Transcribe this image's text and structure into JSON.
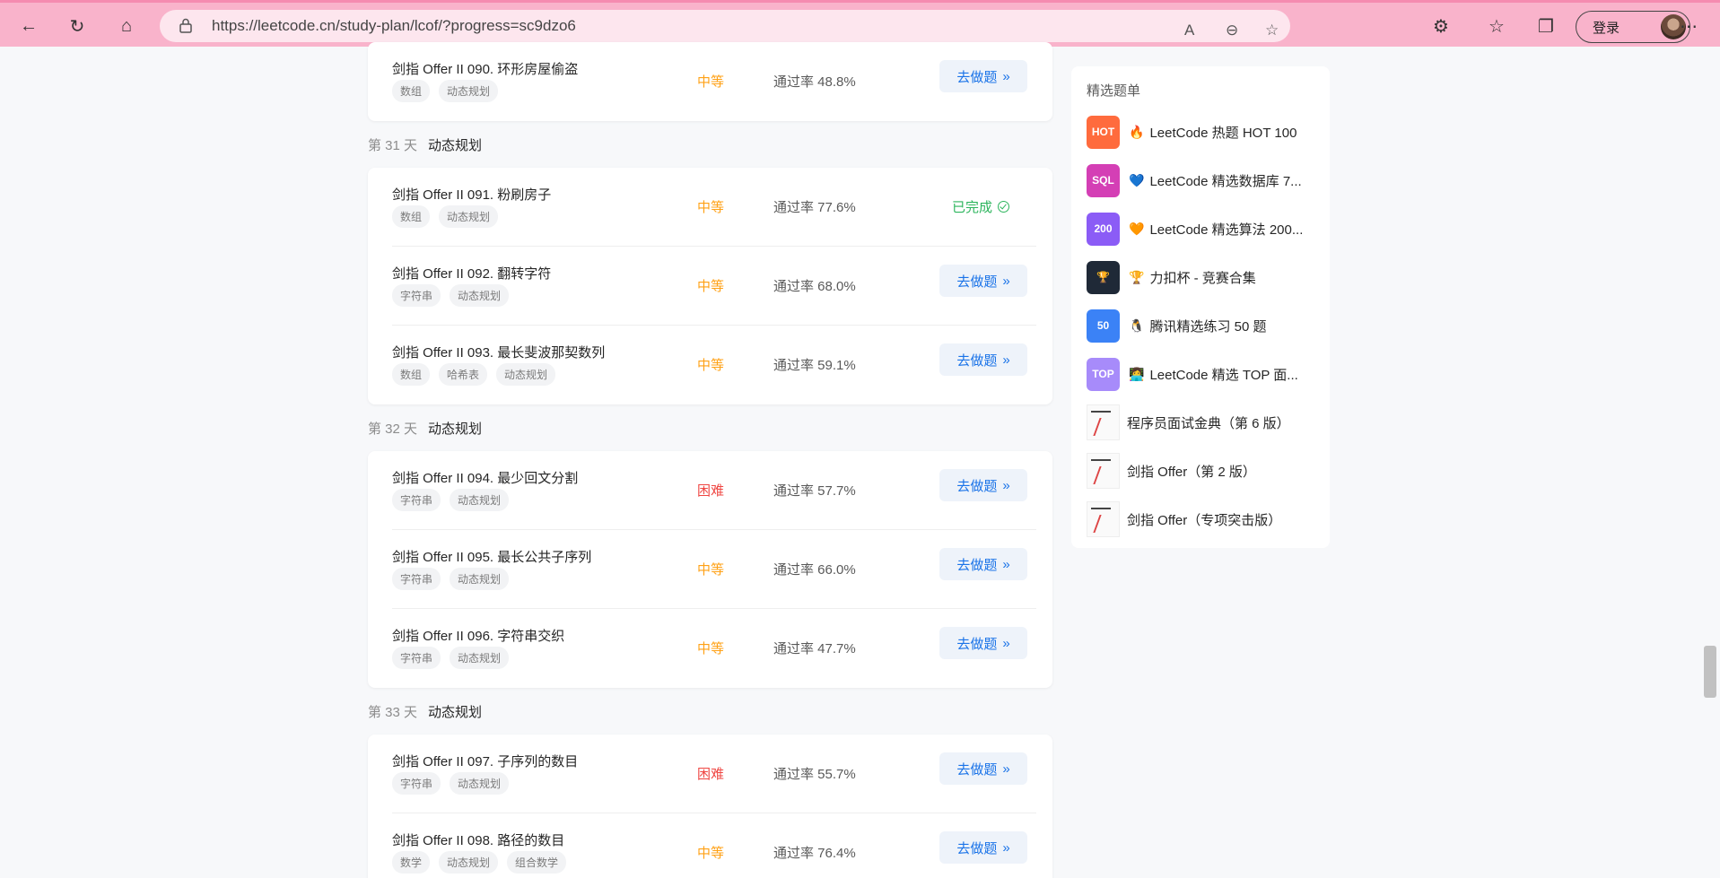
{
  "browser": {
    "url": "https://leetcode.cn/study-plan/lcof/?progress=sc9dzo6",
    "login_label": "登录"
  },
  "first_row": {
    "title": "剑指 Offer II 090. 环形房屋偷盗",
    "tags": [
      "数组",
      "动态规划"
    ],
    "difficulty": "中等",
    "rate": "通过率 48.8%",
    "action": "去做题"
  },
  "days": [
    {
      "num": "第 31 天",
      "topic": "动态规划",
      "problems": [
        {
          "title": "剑指 Offer II 091. 粉刷房子",
          "tags": [
            "数组",
            "动态规划"
          ],
          "difficulty": "中等",
          "rate": "通过率 77.6%",
          "status": "已完成"
        },
        {
          "title": "剑指 Offer II 092. 翻转字符",
          "tags": [
            "字符串",
            "动态规划"
          ],
          "difficulty": "中等",
          "rate": "通过率 68.0%",
          "action": "去做题"
        },
        {
          "title": "剑指 Offer II 093. 最长斐波那契数列",
          "tags": [
            "数组",
            "哈希表",
            "动态规划"
          ],
          "difficulty": "中等",
          "rate": "通过率 59.1%",
          "action": "去做题"
        }
      ]
    },
    {
      "num": "第 32 天",
      "topic": "动态规划",
      "problems": [
        {
          "title": "剑指 Offer II 094. 最少回文分割",
          "tags": [
            "字符串",
            "动态规划"
          ],
          "difficulty": "困难",
          "rate": "通过率 57.7%",
          "action": "去做题"
        },
        {
          "title": "剑指 Offer II 095. 最长公共子序列",
          "tags": [
            "字符串",
            "动态规划"
          ],
          "difficulty": "中等",
          "rate": "通过率 66.0%",
          "action": "去做题"
        },
        {
          "title": "剑指 Offer II 096. 字符串交织",
          "tags": [
            "字符串",
            "动态规划"
          ],
          "difficulty": "中等",
          "rate": "通过率 47.7%",
          "action": "去做题"
        }
      ]
    },
    {
      "num": "第 33 天",
      "topic": "动态规划",
      "problems": [
        {
          "title": "剑指 Offer II 097. 子序列的数目",
          "tags": [
            "字符串",
            "动态规划"
          ],
          "difficulty": "困难",
          "rate": "通过率 55.7%",
          "action": "去做题"
        },
        {
          "title": "剑指 Offer II 098. 路径的数目",
          "tags": [
            "数学",
            "动态规划",
            "组合数学"
          ],
          "difficulty": "中等",
          "rate": "通过率 76.4%",
          "action": "去做题"
        }
      ]
    }
  ],
  "side": {
    "title": "精选题单",
    "plans": [
      {
        "thumb": "HOT",
        "color": "#ff6b3d",
        "emoji": "🔥",
        "label": "LeetCode 热题 HOT 100"
      },
      {
        "thumb": "SQL",
        "color": "#d43fb5",
        "emoji": "💙",
        "label": "LeetCode 精选数据库 7..."
      },
      {
        "thumb": "200",
        "color": "#8b5cf6",
        "emoji": "🧡",
        "label": "LeetCode 精选算法 200..."
      },
      {
        "thumb": "🏆",
        "color": "#1f2937",
        "emoji": "🏆",
        "label": "力扣杯 - 竞赛合集"
      },
      {
        "thumb": "50",
        "color": "#3b82f6",
        "emoji": "🐧",
        "label": "腾讯精选练习 50 题"
      },
      {
        "thumb": "TOP",
        "color": "#a78bfa",
        "emoji": "👩‍💻",
        "label": "LeetCode 精选 TOP 面..."
      }
    ],
    "books": [
      {
        "label": "程序员面试金典（第 6 版）"
      },
      {
        "label": "剑指 Offer（第 2 版）"
      },
      {
        "label": "剑指 Offer（专项突击版）"
      }
    ]
  }
}
